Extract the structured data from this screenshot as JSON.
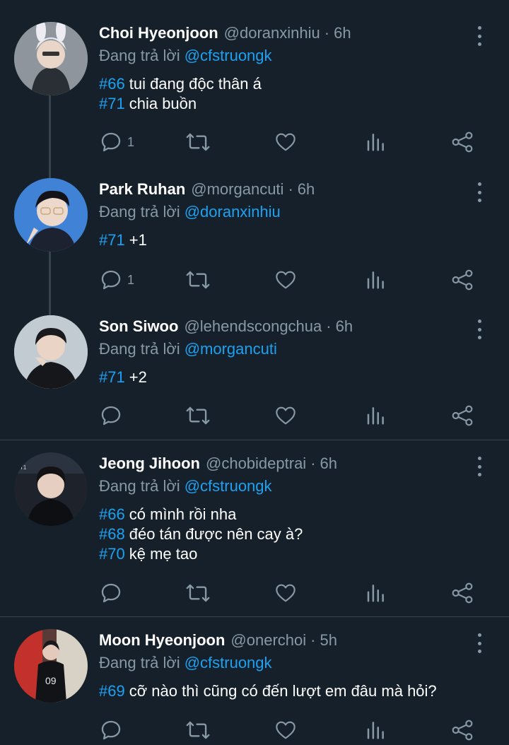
{
  "colors": {
    "background": "#15202b",
    "text": "#ffffff",
    "secondary": "#8899a6",
    "link": "#1da1f2",
    "separator": "#38444d"
  },
  "reply_prefix": "Đang trả lời",
  "tweets": [
    {
      "name": "Choi Hyeonjoon",
      "handle": "@doranxinhiu",
      "time": "6h",
      "reply_to": "@cfstruongk",
      "lines": [
        {
          "tag": "#66",
          "text": "tui đang độc thân á"
        },
        {
          "tag": "#71",
          "text": "chia buồn"
        }
      ],
      "reply_count": "1",
      "avatar_icon": "avatar-photo"
    },
    {
      "name": "Park Ruhan",
      "handle": "@morgancuti",
      "time": "6h",
      "reply_to": "@doranxinhiu",
      "lines": [
        {
          "tag": "#71",
          "text": "+1"
        }
      ],
      "reply_count": "1",
      "avatar_icon": "avatar-photo"
    },
    {
      "name": "Son Siwoo",
      "handle": "@lehendscongchua",
      "time": "6h",
      "reply_to": "@morgancuti",
      "lines": [
        {
          "tag": "#71",
          "text": "+2"
        }
      ],
      "reply_count": "",
      "avatar_icon": "avatar-photo"
    },
    {
      "name": "Jeong Jihoon",
      "handle": "@chobideptrai",
      "time": "6h",
      "reply_to": "@cfstruongk",
      "lines": [
        {
          "tag": "#66",
          "text": "có mình rồi nha"
        },
        {
          "tag": "#68",
          "text": "đéo tán được nên cay à?"
        },
        {
          "tag": "#70",
          "text": "kệ mẹ tao"
        }
      ],
      "reply_count": "",
      "avatar_icon": "avatar-photo"
    },
    {
      "name": "Moon Hyeonjoon",
      "handle": "@onerchoi",
      "time": "5h",
      "reply_to": "@cfstruongk",
      "lines": [
        {
          "tag": "#69",
          "text": "cỡ nào thì cũng có đến lượt em đâu mà hỏi?"
        }
      ],
      "reply_count": "",
      "avatar_icon": "avatar-photo"
    }
  ],
  "action_icons": [
    "reply-icon",
    "retweet-icon",
    "like-icon",
    "analytics-icon",
    "share-icon"
  ]
}
